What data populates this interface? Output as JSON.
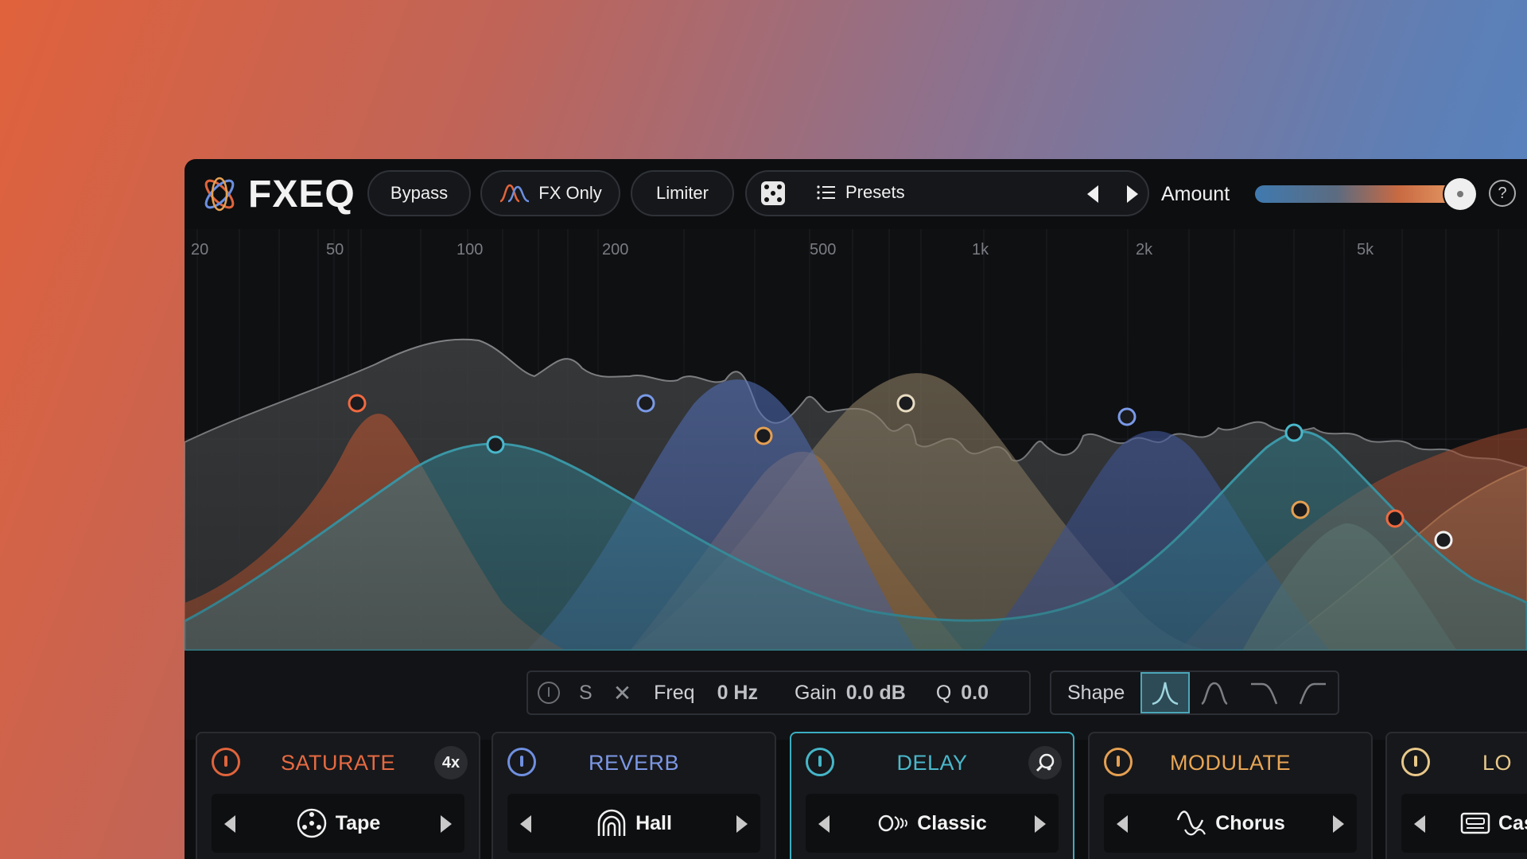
{
  "app": {
    "brand": "FXEQ"
  },
  "toolbar": {
    "bypass_label": "Bypass",
    "fxonly_label": "FX Only",
    "limiter_label": "Limiter",
    "presets_label": "Presets",
    "amount_label": "Amount",
    "amount_level": 1.0,
    "help_glyph": "?"
  },
  "graph": {
    "freq_labels": [
      "20",
      "50",
      "100",
      "200",
      "500",
      "1k",
      "2k",
      "5k"
    ]
  },
  "band_controls": {
    "solo_label": "S",
    "freq_label": "Freq",
    "freq_value": "0 Hz",
    "gain_label": "Gain",
    "gain_value": "0.0 dB",
    "q_label": "Q",
    "q_value": "0.0",
    "shape_label": "Shape"
  },
  "modules": [
    {
      "title": "SATURATE",
      "badge": "4x",
      "preset": "Tape",
      "color": "#e0643c",
      "icon": "tape-icon"
    },
    {
      "title": "REVERB",
      "preset": "Hall",
      "color": "#7c98e6",
      "icon": "hall-icon"
    },
    {
      "title": "DELAY",
      "preset": "Classic",
      "color": "#4ab8cc",
      "icon": "echo-icon"
    },
    {
      "title": "MODULATE",
      "preset": "Chorus",
      "color": "#e5a052",
      "icon": "chorus-icon"
    },
    {
      "title": "LO",
      "preset": "Cas",
      "color": "#e8c88a",
      "icon": "cassette-icon"
    }
  ],
  "colors": {
    "saturate": "#e0643c",
    "reverb": "#5f82d8",
    "delay": "#45b6c8",
    "modulate": "#e2a058",
    "lofi": "#d9bf8e"
  }
}
